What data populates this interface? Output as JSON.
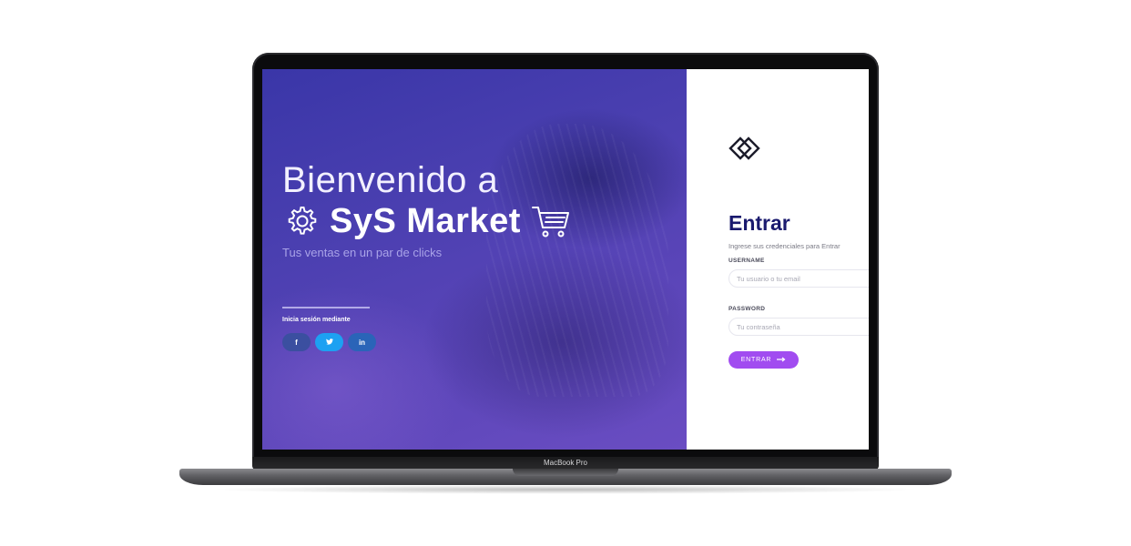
{
  "device": {
    "model_label": "MacBook Pro"
  },
  "hero": {
    "welcome": "Bienvenido a",
    "brand": "SyS Market",
    "tagline": "Tus ventas en un par de clicks",
    "social_label": "Inicia sesión mediante",
    "social": [
      {
        "label": "f",
        "icon": "facebook-icon",
        "color": "#3b4fa0"
      },
      {
        "label": " ",
        "icon": "twitter-icon",
        "color": "#1da1f2"
      },
      {
        "label": "in",
        "icon": "linkedin-icon",
        "color": "#2a64b8"
      }
    ],
    "gradient_colors": [
      "#3a36a8",
      "#6a4dc2"
    ]
  },
  "login": {
    "title": "Entrar",
    "subtitle": "Ingrese sus credenciales para Entrar",
    "username": {
      "label": "USERNAME",
      "placeholder": "Tu usuario o tu email",
      "value": ""
    },
    "password": {
      "label": "PASSWORD",
      "placeholder": "Tu contraseña",
      "value": ""
    },
    "submit_label": "ENTRAR",
    "submit_icon": "arrow-right-icon",
    "accent_color": "#a14cf0",
    "title_color": "#1a1a6e"
  }
}
